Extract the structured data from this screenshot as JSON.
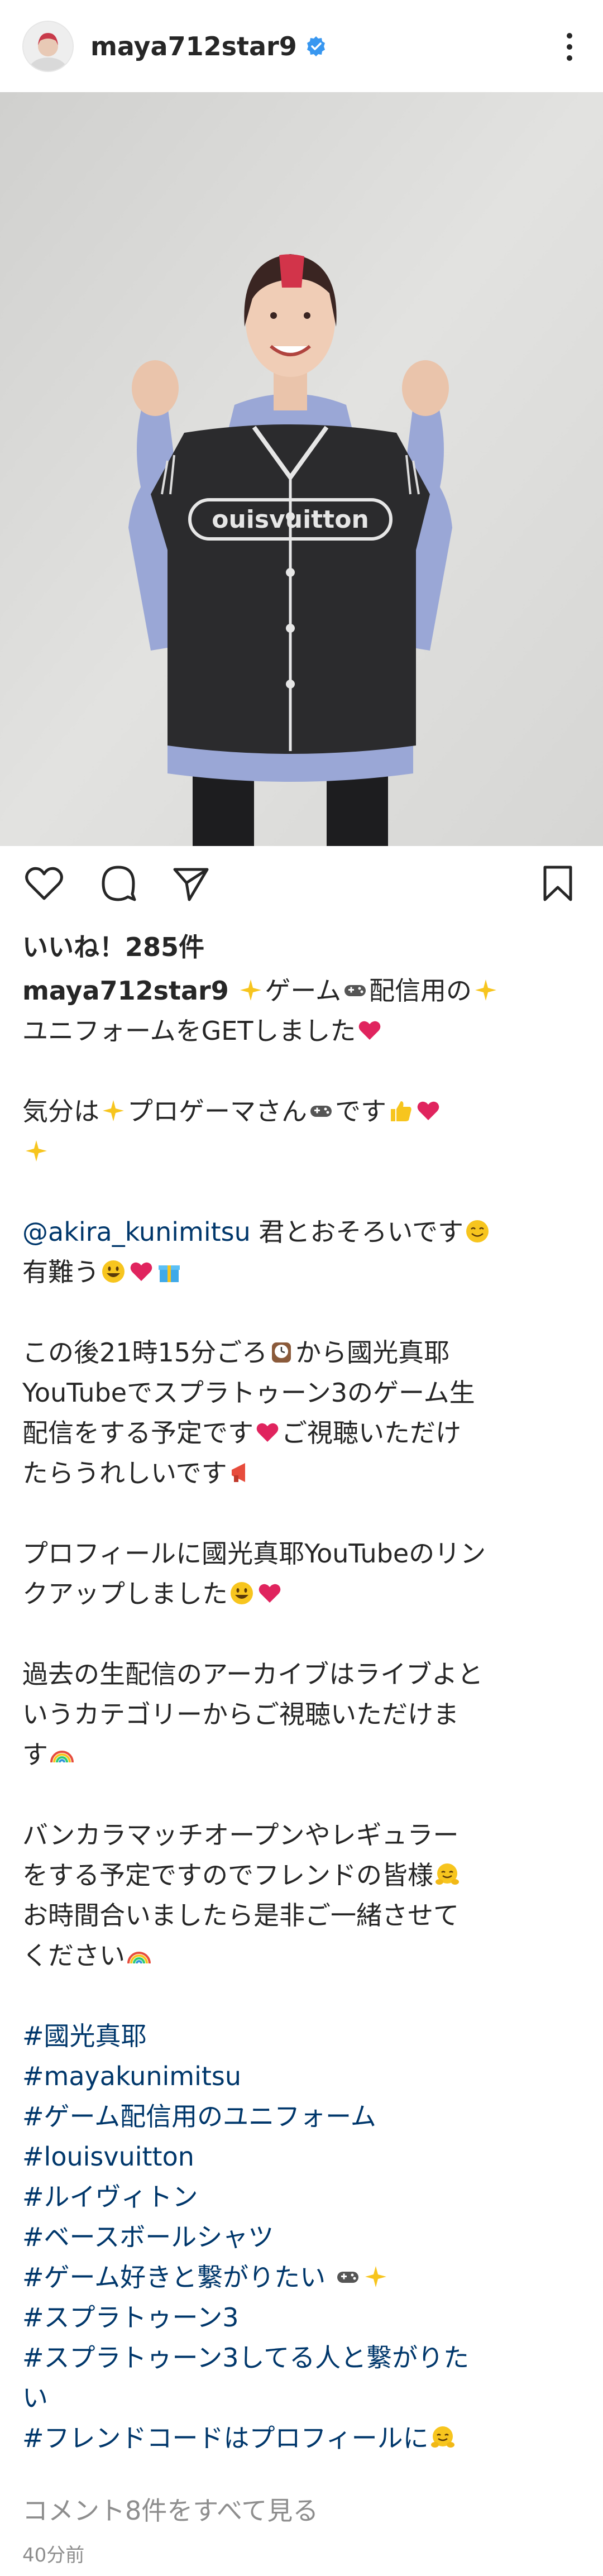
{
  "header": {
    "username": "maya712star9",
    "verified_icon": "verified-badge-icon",
    "more_icon": "more-vertical-icon"
  },
  "actions": {
    "like_icon": "heart-outline-icon",
    "comment_icon": "comment-bubble-icon",
    "share_icon": "paper-plane-icon",
    "save_icon": "bookmark-outline-icon"
  },
  "likes": "いいね！285件",
  "caption": {
    "username": "maya712star9",
    "line1_a": "ゲーム",
    "line1_b": "配信用の",
    "line2": "ユニフォームをGETしました",
    "p2_a": "気分は",
    "p2_b": "プロゲーマさん",
    "p2_c": "です",
    "mention": "@akira_kunimitsu",
    "p3_a": " 君とおそろいです",
    "p3_b": "有難う",
    "p4_a": "この後21時15分ごろ",
    "p4_b": "から國光真耶",
    "p4_c": "YouTubeでスプラトゥーン3のゲーム生",
    "p4_d": "配信をする予定です",
    "p4_e": "ご視聴いただけ",
    "p4_f": "たらうれしいです",
    "p5_a": "プロフィールに國光真耶YouTubeのリン",
    "p5_b": "クアップしました",
    "p6_a": "過去の生配信のアーカイブはライブよと",
    "p6_b": "いうカテゴリーからご視聴いただけま",
    "p6_c": "す",
    "p7_a": "バンカラマッチオープンやレギュラー",
    "p7_b": "をする予定ですのでフレンドの皆様",
    "p7_c": "お時間合いましたら是非ご一緒させて",
    "p7_d": "ください",
    "hashtags": [
      "#國光真耶",
      "#mayakunimitsu",
      "#ゲーム配信用のユニフォーム",
      "#louisvuitton",
      "#ルイヴィトン",
      "#ベースボールシャツ",
      "#ゲーム好きと繋がりたい",
      "#スプラトゥーン3",
      "#スプラトゥーン3してる人と繋がりた",
      "い",
      "#フレンドコードはプロフィールに"
    ]
  },
  "comments_link": "コメント8件をすべて見る",
  "timestamp": "40分前",
  "colors": {
    "text": "#262626",
    "link": "#00376b",
    "secondary": "#8e8e8e",
    "verified": "#3897f0",
    "heart": "#e0245e"
  }
}
